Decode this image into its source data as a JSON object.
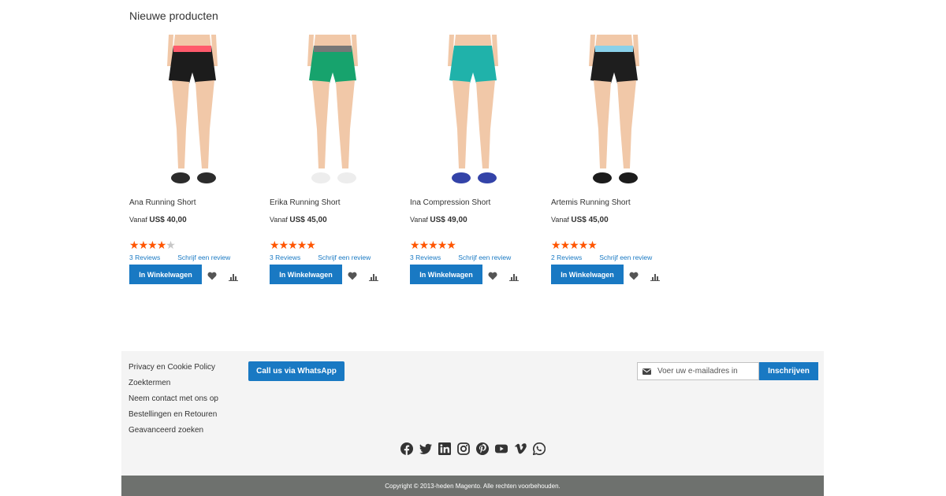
{
  "section_title": "Nieuwe producten",
  "products": [
    {
      "name": "Ana Running Short",
      "price_prefix": "Vanaf",
      "price": "US$ 40,00",
      "rating": 4,
      "rating_max": 5,
      "reviews": "3  Reviews",
      "write_review": "Schrijf een review",
      "cart_label": "In Winkelwagen",
      "image_icon": "black-running-shorts-photo",
      "colors": {
        "shorts": "#1c1c1c",
        "trim": "#ff5a6b",
        "shoes": "#2c2c2c"
      }
    },
    {
      "name": "Erika Running Short",
      "price_prefix": "Vanaf",
      "price": "US$ 45,00",
      "rating": 5,
      "rating_max": 5,
      "reviews": "3  Reviews",
      "write_review": "Schrijf een review",
      "cart_label": "In Winkelwagen",
      "image_icon": "green-running-shorts-photo",
      "colors": {
        "shorts": "#17a36d",
        "trim": "#777777",
        "shoes": "#ededed"
      }
    },
    {
      "name": "Ina Compression Short",
      "price_prefix": "Vanaf",
      "price": "US$ 49,00",
      "rating": 5,
      "rating_max": 5,
      "reviews": "3  Reviews",
      "write_review": "Schrijf een review",
      "cart_label": "In Winkelwagen",
      "image_icon": "teal-compression-shorts-photo",
      "colors": {
        "shorts": "#20b2aa",
        "trim": "#20b2aa",
        "shoes": "#3343a8"
      }
    },
    {
      "name": "Artemis Running Short",
      "price_prefix": "Vanaf",
      "price": "US$ 45,00",
      "rating": 5,
      "rating_max": 5,
      "reviews": "2  Reviews",
      "write_review": "Schrijf een review",
      "cart_label": "In Winkelwagen",
      "image_icon": "black-blue-running-shorts-photo",
      "colors": {
        "shorts": "#1e1e1e",
        "trim": "#8ad1ea",
        "shoes": "#1c1c1c"
      }
    }
  ],
  "footer": {
    "links": [
      "Privacy en Cookie Policy",
      "Zoektermen",
      "Neem contact met ons op",
      "Bestellingen en Retouren",
      "Geavanceerd zoeken"
    ],
    "whatsapp_label": "Call us via WhatsApp",
    "newsletter_placeholder": "Voer uw e-mailadres in",
    "subscribe_label": "Inschrijven",
    "social_icons": [
      "facebook-icon",
      "twitter-icon",
      "linkedin-icon",
      "instagram-icon",
      "pinterest-icon",
      "youtube-icon",
      "vimeo-icon",
      "whatsapp-icon"
    ],
    "copyright": "Copyright © 2013-heden Magento. Alle rechten voorbehouden."
  },
  "colors": {
    "accent": "#1979c3",
    "star": "#ff5501",
    "footer_bg": "#f4f4f4",
    "copyright_bg": "#6e716e"
  }
}
